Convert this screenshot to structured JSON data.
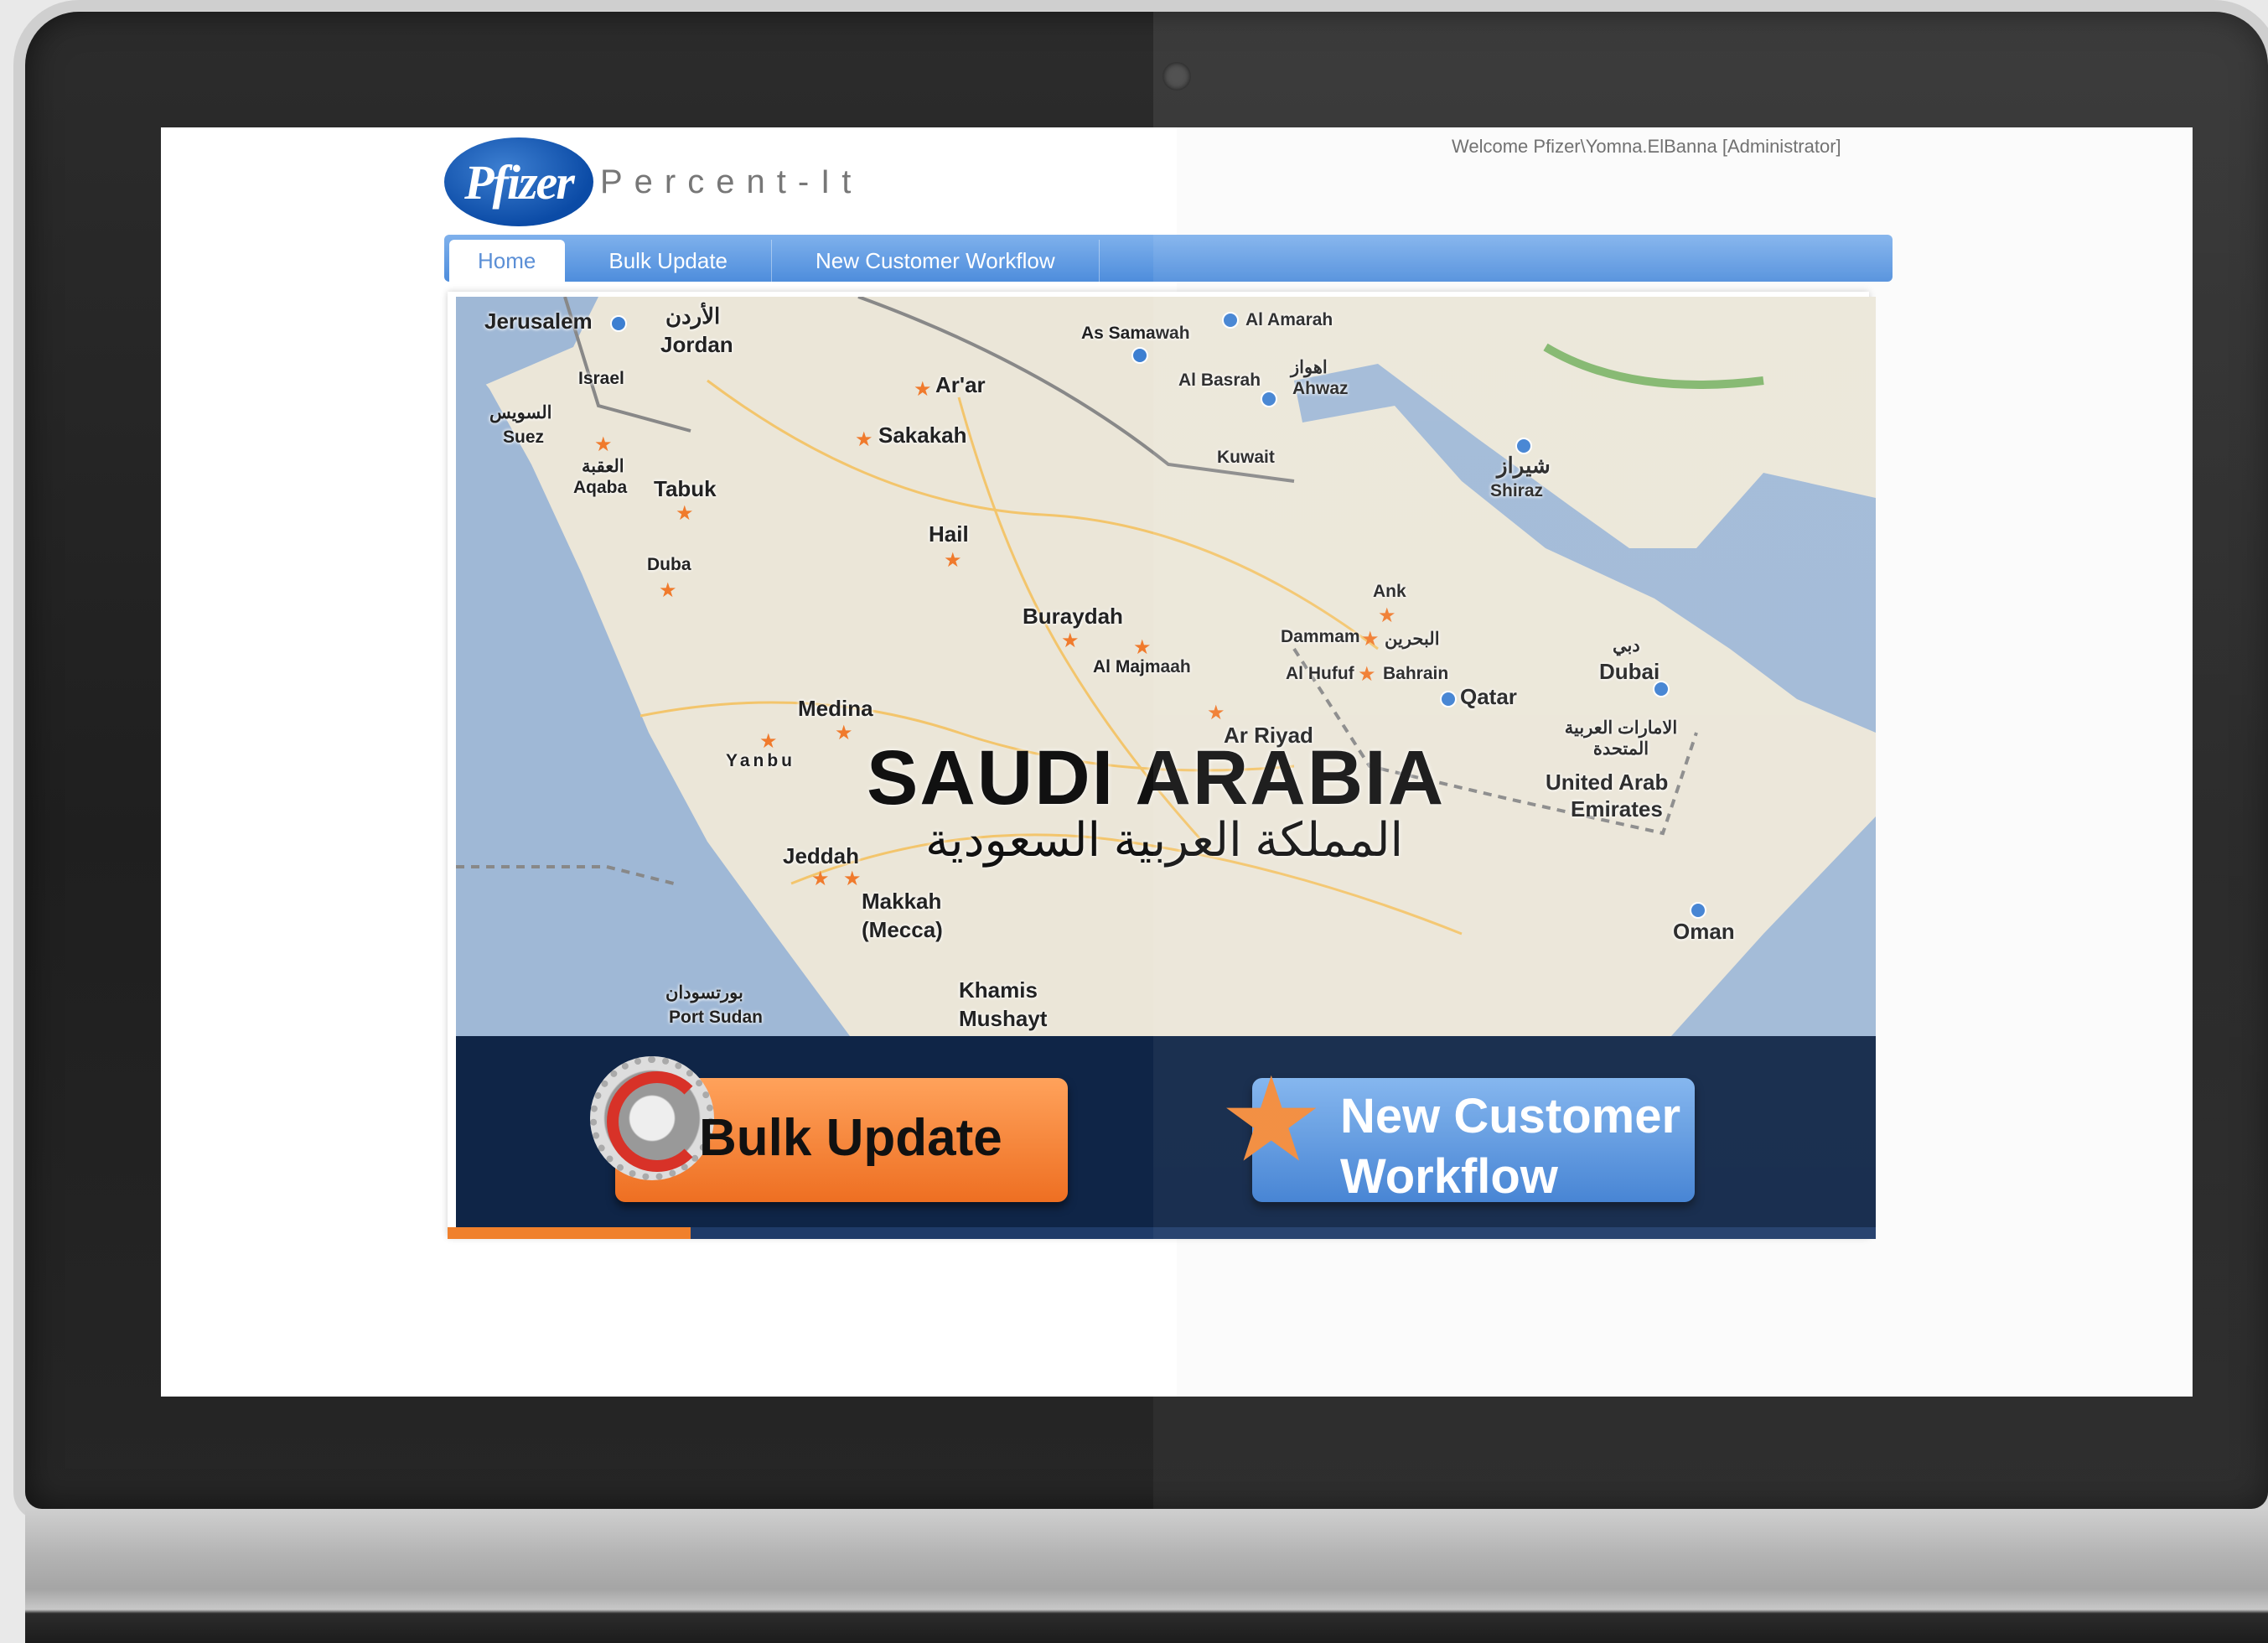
{
  "header": {
    "welcome": "Welcome Pfizer\\Yomna.ElBanna [Administrator]",
    "logo_text": "Pfizer",
    "app_name": "Percent-It"
  },
  "nav": {
    "tabs": [
      {
        "label": "Home",
        "active": true
      },
      {
        "label": "Bulk Update",
        "active": false
      },
      {
        "label": "New Customer Workflow",
        "active": false
      }
    ]
  },
  "map": {
    "title": "SAUDI ARABIA",
    "subtitle": "المملكة العربية السعودية",
    "cities": {
      "jerusalem": "Jerusalem",
      "jordan": "Jordan",
      "jordan_ar": "الأردن",
      "israel": "Israel",
      "suez": "Suez",
      "suez_ar": "السويس",
      "aqaba": "Aqaba",
      "aqaba_ar": "العقبة",
      "tabuk": "Tabuk",
      "duba": "Duba",
      "arar": "Ar'ar",
      "sakakah": "Sakakah",
      "hail": "Hail",
      "buraydah": "Buraydah",
      "almajmaah": "Al Majmaah",
      "medina": "Medina",
      "yanbu": "Yanbu",
      "jeddah": "Jeddah",
      "makkah": "Makkah",
      "mecca": "(Mecca)",
      "khamis": "Khamis",
      "mushayt": "Mushayt",
      "portsudan": "Port Sudan",
      "portsudan_ar": "بورتسودان",
      "assamawah": "As Samawah",
      "alamarah": "Al Amarah",
      "albasrah": "Al Basrah",
      "ahwaz": "Ahwaz",
      "ahwaz_ar": "اهواز",
      "kuwait": "Kuwait",
      "shiraz": "Shiraz",
      "shiraz_ar": "شيراز",
      "ank": "Ank",
      "dammam": "Dammam",
      "bahrain": "Bahrain",
      "bahrain_ar": "البحرين",
      "alhufuf": "Al Hufuf",
      "qatar": "Qatar",
      "dubai": "Dubai",
      "dubai_ar": "دبي",
      "arriyad": "Ar Riyad",
      "uae1": "United Arab",
      "uae2": "Emirates",
      "uae_ar": "الامارات العربية المتحدة",
      "oman": "Oman"
    }
  },
  "actions": {
    "bulk_update": "Bulk Update",
    "new_customer_line1": "New Customer",
    "new_customer_line2": "Workflow"
  },
  "progress": {
    "fraction": 0.17
  },
  "colors": {
    "accent_blue": "#4e8ddc",
    "accent_orange": "#ee6f22",
    "action_bar_bg": "#0f2547"
  }
}
